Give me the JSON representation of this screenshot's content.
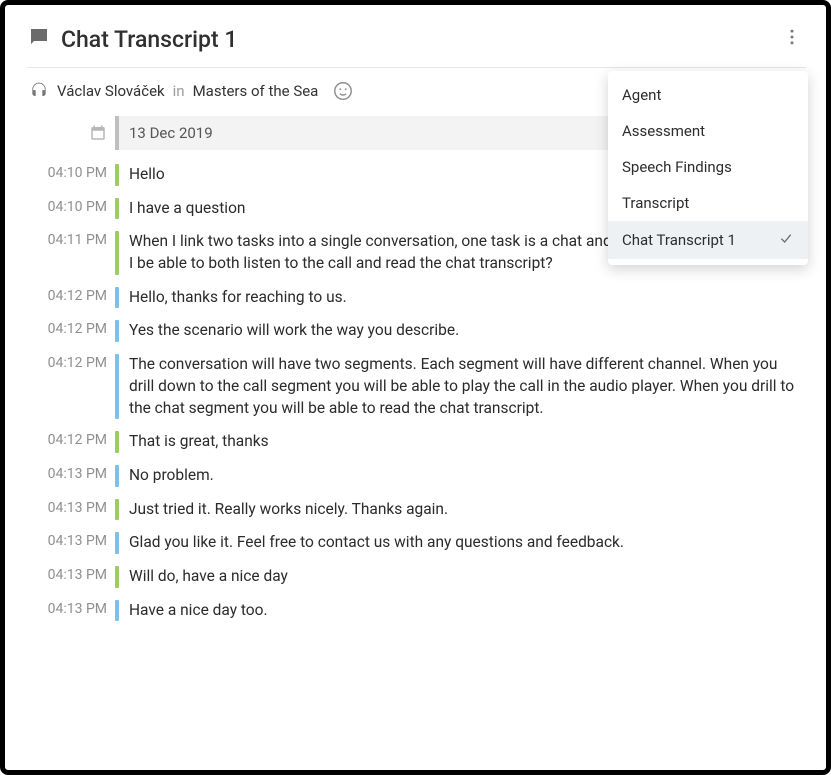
{
  "header": {
    "title": "Chat Transcript 1"
  },
  "agent": {
    "name": "Václav Slováček",
    "in": "in",
    "queue": "Masters of the Sea"
  },
  "date_label": "13 Dec 2019",
  "dropdown": {
    "items": [
      {
        "label": "Agent",
        "selected": false
      },
      {
        "label": "Assessment",
        "selected": false
      },
      {
        "label": "Speech Findings",
        "selected": false
      },
      {
        "label": "Transcript",
        "selected": false
      },
      {
        "label": "Chat Transcript 1",
        "selected": true
      }
    ]
  },
  "colors": {
    "customer": "#9ccc65",
    "agent": "#81c0e6"
  },
  "messages": [
    {
      "time": "04:10 PM",
      "side": "green",
      "text": "Hello"
    },
    {
      "time": "04:10 PM",
      "side": "green",
      "text": "I have a question"
    },
    {
      "time": "04:11 PM",
      "side": "green",
      "text": "When I link two tasks into a single conversation, one task is a chat and the other task is a call. Will I be able to both listen to the call and read the chat transcript?"
    },
    {
      "time": "04:12 PM",
      "side": "blue",
      "text": "Hello, thanks for reaching to us."
    },
    {
      "time": "04:12 PM",
      "side": "blue",
      "text": "Yes the scenario will work the way you describe."
    },
    {
      "time": "04:12 PM",
      "side": "blue",
      "text": "The conversation will have two segments. Each segment will have different channel. When you drill down to the call segment you will be able to play the call in the audio player. When you drill to the chat segment you will be able to read the chat transcript."
    },
    {
      "time": "04:12 PM",
      "side": "green",
      "text": "That is great, thanks"
    },
    {
      "time": "04:13 PM",
      "side": "blue",
      "text": "No problem."
    },
    {
      "time": "04:13 PM",
      "side": "green",
      "text": "Just tried it. Really works nicely. Thanks again."
    },
    {
      "time": "04:13 PM",
      "side": "blue",
      "text": "Glad you like it. Feel free to contact us with any questions and feedback."
    },
    {
      "time": "04:13 PM",
      "side": "green",
      "text": "Will do, have a nice day"
    },
    {
      "time": "04:13 PM",
      "side": "blue",
      "text": "Have a nice day too."
    }
  ]
}
